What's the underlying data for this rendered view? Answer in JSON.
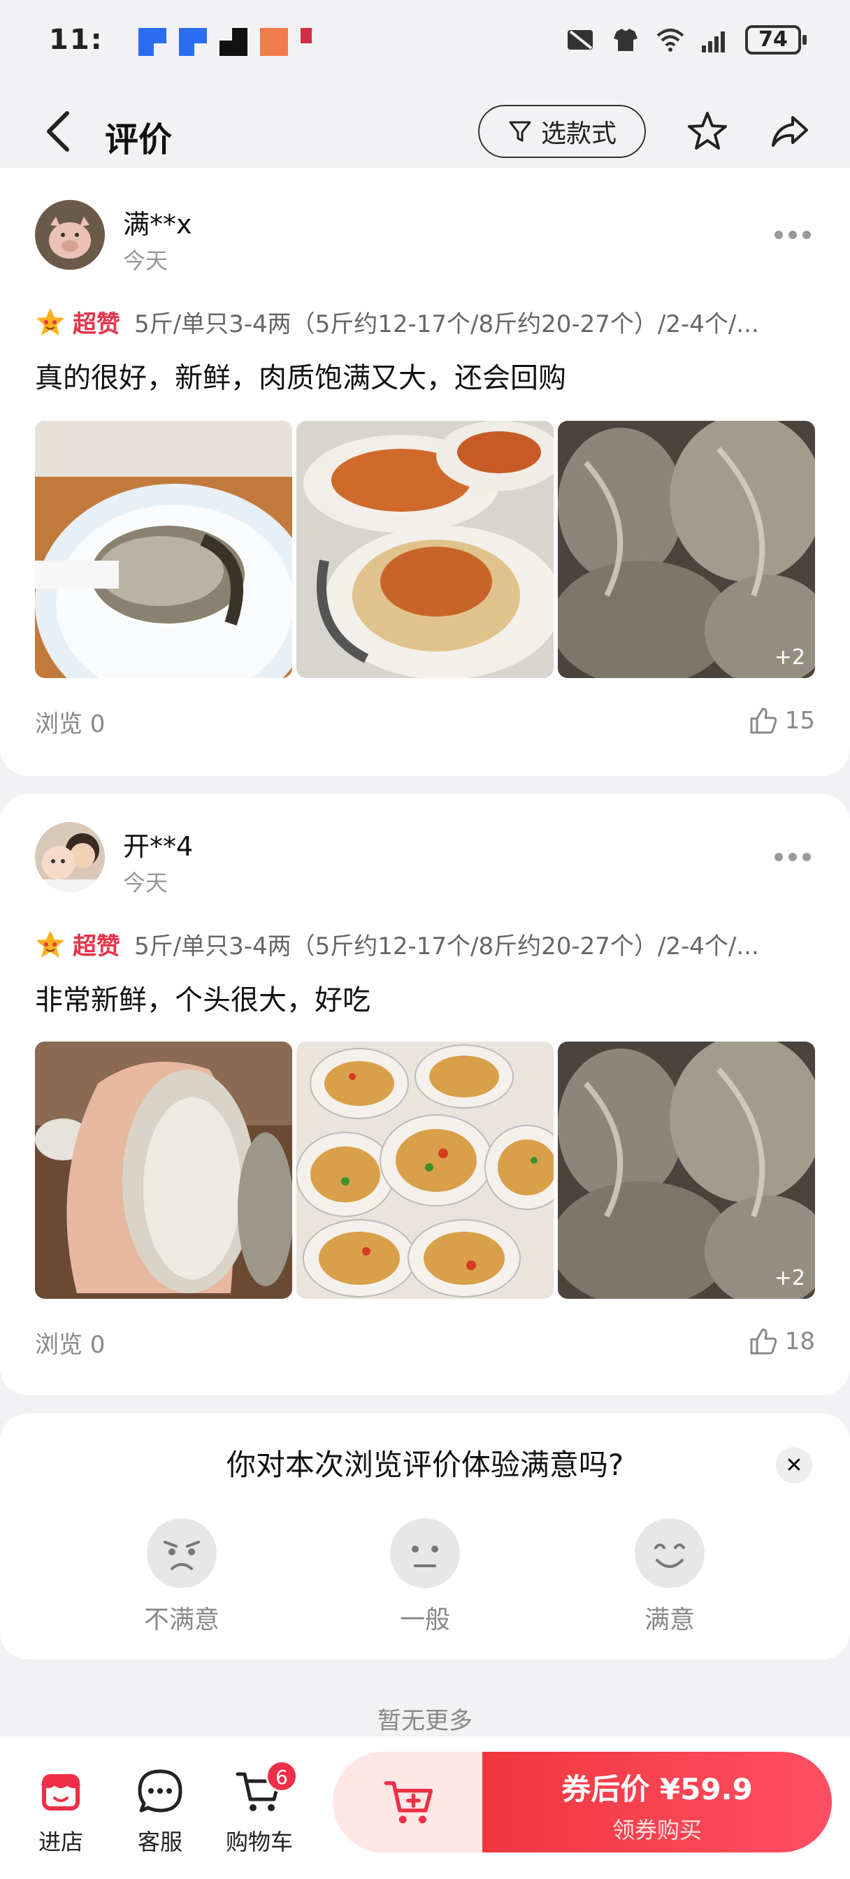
{
  "status_bar": {
    "time": "11:",
    "battery": "74"
  },
  "header": {
    "back_icon": "chevron-left-icon",
    "title": "评价",
    "filter_label": "选款式",
    "filter_icon": "funnel-icon",
    "favorite_icon": "star-outline-icon",
    "share_icon": "share-arrow-icon"
  },
  "reviews": [
    {
      "username": "满**x",
      "date": "今天",
      "tag": "超赞",
      "spec": "5斤/单只3-4两（5斤约12-17个/8斤约20-27个）/2-4个/...",
      "text": "真的很好，新鲜，肉质饱满又大，还会回购",
      "more_photos": "+2",
      "views": "浏览 0",
      "likes": "15"
    },
    {
      "username": "开**4",
      "date": "今天",
      "tag": "超赞",
      "spec": "5斤/单只3-4两（5斤约12-17个/8斤约20-27个）/2-4个/...",
      "text": "非常新鲜，个头很大，好吃",
      "more_photos": "+2",
      "views": "浏览 0",
      "likes": "18"
    }
  ],
  "survey": {
    "question": "你对本次浏览评价体验满意吗?",
    "close": "✕",
    "options": [
      "不满意",
      "一般",
      "满意"
    ]
  },
  "no_more": "暂无更多",
  "bottom_bar": {
    "store_label": "进店",
    "service_label": "客服",
    "cart_label": "购物车",
    "cart_count": "6",
    "buy_price": "券后价 ¥59.9",
    "buy_sub": "领券购买"
  },
  "colors": {
    "accent": "#ee2f47",
    "tag_red": "#e8334a",
    "background": "#f2f2f4"
  }
}
